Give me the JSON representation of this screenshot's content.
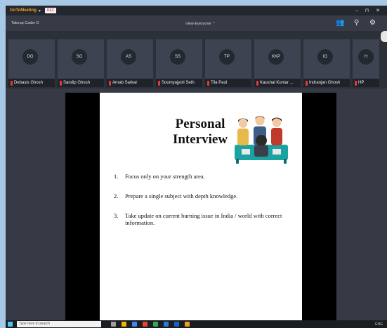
{
  "app": {
    "name": "GoToMeeting",
    "rec_label": "REC",
    "window_controls": "– ⊓ ✕"
  },
  "toolbar": {
    "meeting_title": "Takeup Cader D",
    "view_label": "View Everyone ⌃"
  },
  "participants": [
    {
      "initials": "DG",
      "name": "Debasis Ghosh"
    },
    {
      "initials": "SG",
      "name": "Sandip Ghosh"
    },
    {
      "initials": "AS",
      "name": "Arnab Sarkar"
    },
    {
      "initials": "SS",
      "name": "Soumyajyoti Seth"
    },
    {
      "initials": "TP",
      "name": "Tila Paul"
    },
    {
      "initials": "KKP",
      "name": "Kaushal Kumar ..."
    },
    {
      "initials": "IG",
      "name": "Indranjan Ghosh"
    },
    {
      "initials": "H",
      "name": "HP"
    }
  ],
  "slide": {
    "title_line1": "Personal",
    "title_line2": "Interview",
    "points": [
      {
        "num": "1.",
        "text": "Focus only on your strength area."
      },
      {
        "num": "2.",
        "text": "Prepare a single subject with depth knowledge."
      },
      {
        "num": "3.",
        "text": "Take update on current burning issue in India / world with correct information."
      }
    ]
  },
  "taskbar": {
    "search_placeholder": "Type here to search",
    "tray_text": "ENG"
  },
  "colors": {
    "accent": "#f0a020",
    "mic_muted": "#e53935"
  }
}
